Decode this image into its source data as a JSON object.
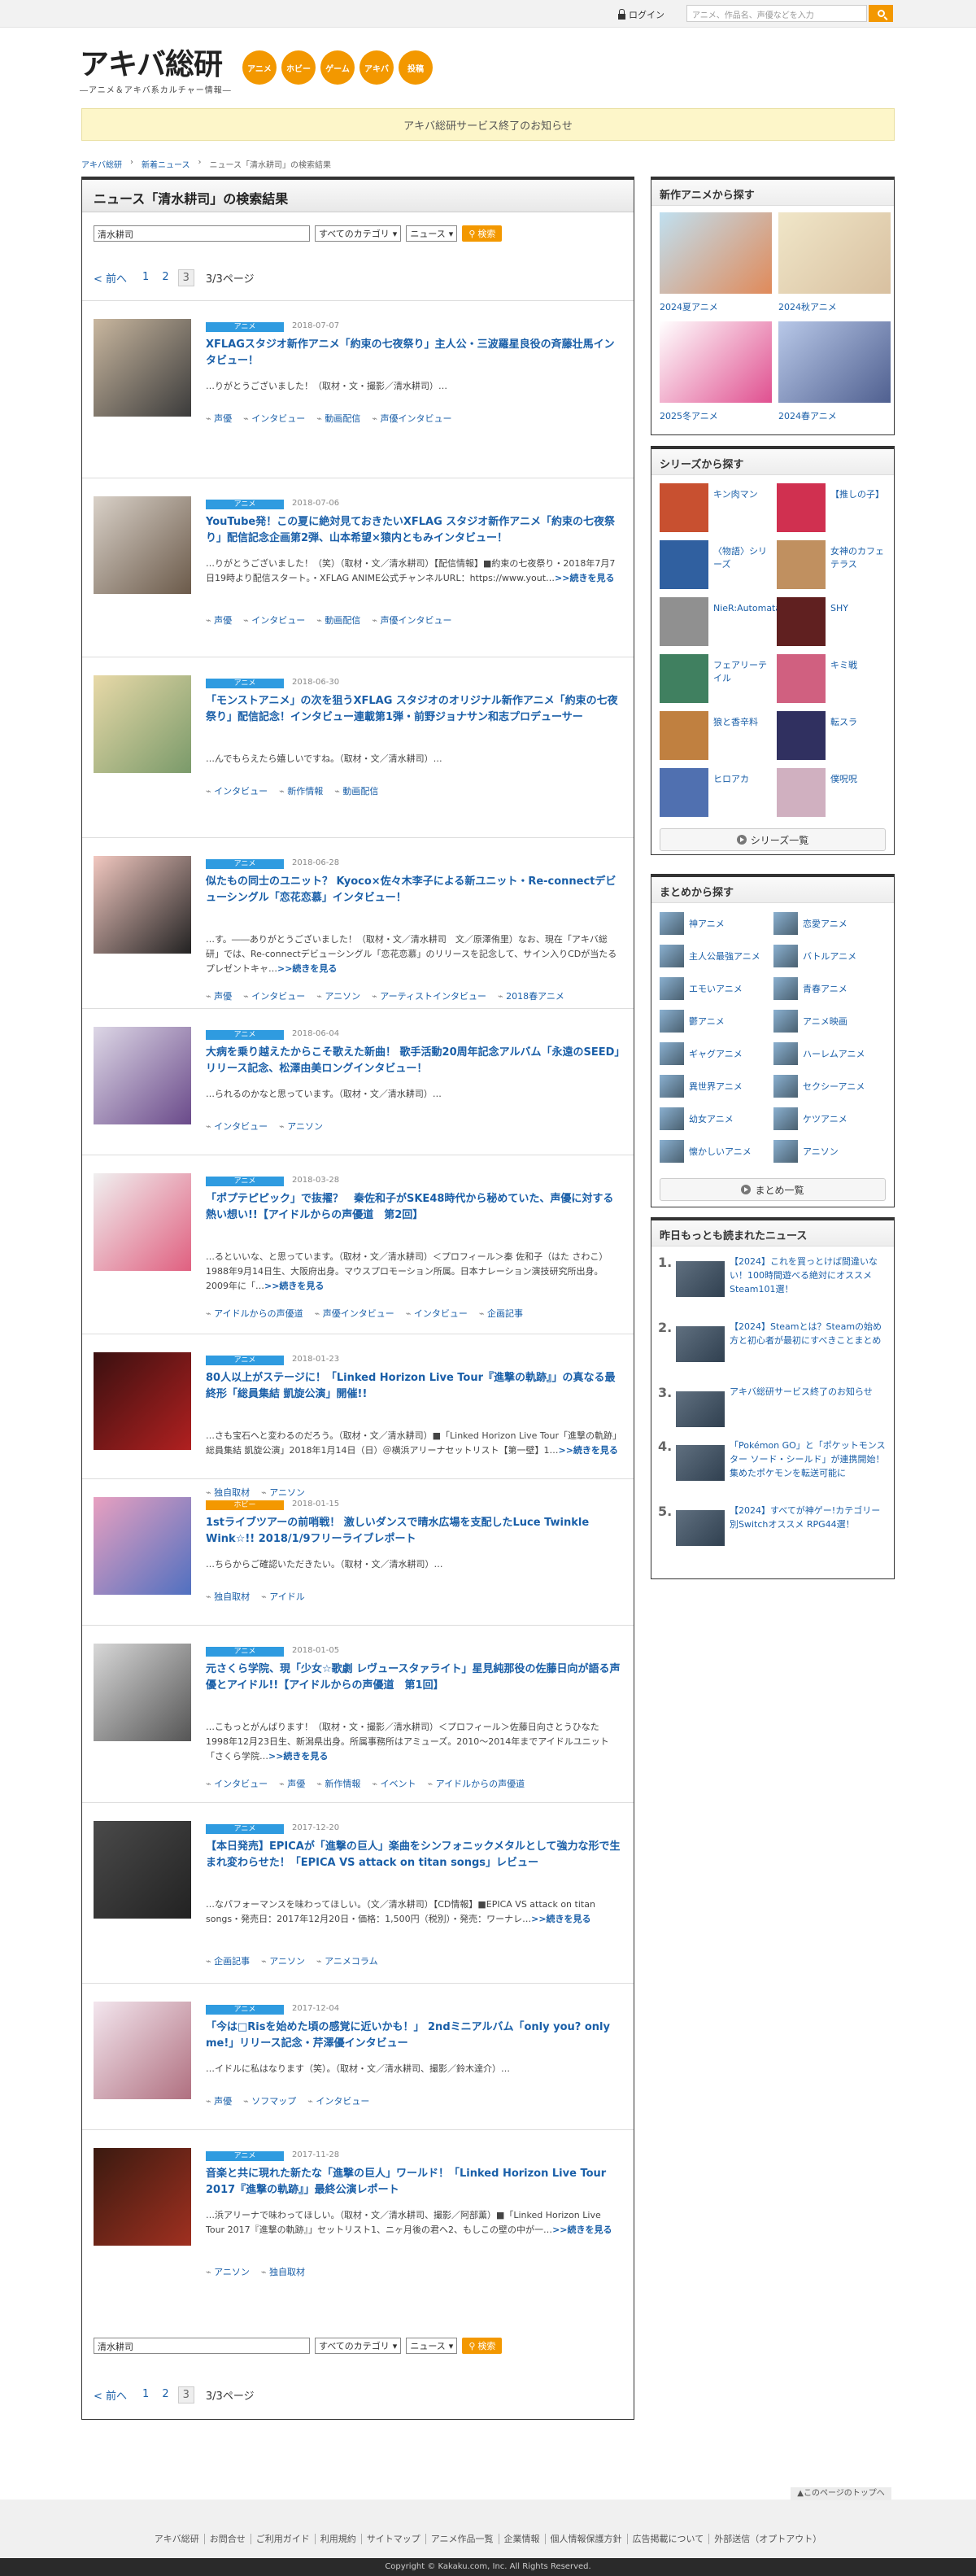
{
  "header": {
    "login": "ログイン",
    "search_placeholder": "アニメ、作品名、声優などを入力",
    "logo": "アキバ総研",
    "logo_sub": "―アニメ＆アキバ系カルチャー情報―",
    "categories": [
      "アニメ",
      "ホビー",
      "ゲーム",
      "アキバ",
      "投稿"
    ]
  },
  "notice": "アキバ総研サービス終了のお知らせ",
  "breadcrumb": [
    "アキバ総研",
    "新着ニュース",
    "ニュース「清水耕司」の検索結果"
  ],
  "main": {
    "title": "ニュース「清水耕司」の検索結果",
    "search_value": "清水耕司",
    "category_select": "すべてのカテゴリ",
    "type_select": "ニュース",
    "search_btn": "検索",
    "pager": {
      "prev": "前へ",
      "pages": [
        "1",
        "2",
        "3"
      ],
      "current": "3",
      "summary": "3/3ページ"
    }
  },
  "articles": [
    {
      "cat": "アニメ",
      "date": "2018-07-07",
      "title": "XFLAGスタジオ新作アニメ「約束の七夜祭り」主人公・三波羅星良役の斉藤壮馬インタビュー！",
      "summary": "…りがとうございました！（取材・文・撮影／清水耕司）…",
      "more": "",
      "tags": [
        "声優",
        "インタビュー",
        "動画配信",
        "声優インタビュー"
      ]
    },
    {
      "cat": "アニメ",
      "date": "2018-07-06",
      "title": "YouTube発！この夏に絶対見ておきたいXFLAG スタジオ新作アニメ「約束の七夜祭り」配信記念企画第2弾、山本希望×猿内ともみインタビュー！",
      "summary": "…りがとうございました！（笑）（取材・文／清水耕司）【配信情報】■約束の七夜祭り・2018年7月7日19時より配信スタート。・XFLAG ANIME公式チャンネルURL：https://www.yout…",
      "more": ">>続きを見る",
      "tags": [
        "声優",
        "インタビュー",
        "動画配信",
        "声優インタビュー"
      ]
    },
    {
      "cat": "アニメ",
      "date": "2018-06-30",
      "title": "「モンストアニメ」の次を狙うXFLAG スタジオのオリジナル新作アニメ「約束の七夜祭り」配信記念！インタビュー連載第1弾・前野ジョナサン和志プロデューサー",
      "summary": "…んでもらえたら嬉しいですね。（取材・文／清水耕司）…",
      "more": "",
      "tags": [
        "インタビュー",
        "新作情報",
        "動画配信"
      ]
    },
    {
      "cat": "アニメ",
      "date": "2018-06-28",
      "title": "似たもの同士のユニット？ Kyoco×佐々木李子による新ユニット・Re-connectデビューシングル「恋花恋慕」インタビュー！",
      "summary": "…す。――ありがとうございました！（取材・文／清水耕司　文／原澤侑里）なお、現在「アキバ総研」では、Re-connectデビューシングル「恋花恋慕」のリリースを記念して、サイン入りCDが当たるプレゼントキャ…",
      "more": ">>続きを見る",
      "tags": [
        "声優",
        "インタビュー",
        "アニソン",
        "アーティストインタビュー",
        "2018春アニメ"
      ]
    },
    {
      "cat": "アニメ",
      "date": "2018-06-04",
      "title": "大病を乗り越えたからこそ歌えた新曲！ 歌手活動20周年記念アルバム「永遠のSEED」リリース記念、松澤由美ロングインタビュー！",
      "summary": "…られるのかなと思っています。（取材・文／清水耕司）…",
      "more": "",
      "tags": [
        "インタビュー",
        "アニソン"
      ]
    },
    {
      "cat": "アニメ",
      "date": "2018-03-28",
      "title": "「ポプテピピック」で抜擢？　秦佐和子がSKE48時代から秘めていた、声優に対する熱い想い!!【アイドルからの声優道　第2回】",
      "summary": "…るといいな、と思っています。（取材・文／清水耕司）＜プロフィール＞秦 佐和子（はた さわこ）1988年9月14日生、大阪府出身。マウスプロモーション所属。日本ナレーション演技研究所出身。2009年に「…",
      "more": ">>続きを見る",
      "tags": [
        "アイドルからの声優道",
        "声優インタビュー",
        "インタビュー",
        "企画記事"
      ]
    },
    {
      "cat": "アニメ",
      "date": "2018-01-23",
      "title": "80人以上がステージに！「Linked Horizon Live Tour『進撃の軌跡』」の真なる最終形「総員集結 凱旋公演」開催!!",
      "summary": "…さも宝石へと変わるのだろう。（取材・文／清水耕司）■「Linked Horizon Live Tour「進撃の軌跡」総員集結 凱旋公演」2018年1月14日（日）＠横浜アリーナセットリスト【第一壁】1…",
      "more": ">>続きを見る",
      "tags": [
        "独自取材",
        "アニソン"
      ]
    },
    {
      "cat": "ホビー",
      "date": "2018-01-15",
      "title": "1stライブツアーの前哨戦！ 激しいダンスで晴水広場を支配したLuce Twinkle Wink☆!! 2018/1/9フリーライブレポート",
      "summary": "…ちらからご確認いただきたい。（取材・文／清水耕司）…",
      "more": "",
      "tags": [
        "独自取材",
        "アイドル"
      ]
    },
    {
      "cat": "アニメ",
      "date": "2018-01-05",
      "title": "元さくら学院、現「少女☆歌劇 レヴュースタァライト」星見純那役の佐藤日向が語る声優とアイドル!!【アイドルからの声優道　第1回】",
      "summary": "…こもっとがんばります！（取材・文・撮影／清水耕司）＜プロフィール＞佐藤日向さとうひなた1998年12月23日生、新潟県出身。所属事務所はアミューズ。2010～2014年までアイドルユニット「さくら学院…",
      "more": ">>続きを見る",
      "tags": [
        "インタビュー",
        "声優",
        "新作情報",
        "イベント",
        "アイドルからの声優道"
      ]
    },
    {
      "cat": "アニメ",
      "date": "2017-12-20",
      "title": "【本日発売】EPICAが「進撃の巨人」楽曲をシンフォニックメタルとして強力な形で生まれ変わらせた！「EPICA VS attack on titan songs」レビュー",
      "summary": "…なパフォーマンスを味わってほしい。（文／清水耕司）【CD情報】■EPICA VS attack on titan songs・発売日：2017年12月20日・価格：1,500円（税別）・発売：ワーナレ…",
      "more": ">>続きを見る",
      "tags": [
        "企画記事",
        "アニソン",
        "アニメコラム"
      ]
    },
    {
      "cat": "アニメ",
      "date": "2017-12-04",
      "title": "「今は□Risを始めた頃の感覚に近いかも！」 2ndミニアルバム「only you? only me!」リリース記念・芹澤優インタビュー",
      "summary": "…イドルに私はなります（笑）。（取材・文／清水耕司、撮影／鈴木達介）…",
      "more": "",
      "tags": [
        "声優",
        "ソフマップ",
        "インタビュー"
      ]
    },
    {
      "cat": "アニメ",
      "date": "2017-11-28",
      "title": "音楽と共に現れた新たな「進撃の巨人」ワールド！「Linked Horizon Live Tour 2017『進撃の軌跡』」最終公演レポート",
      "summary": "…浜アリーナで味わってほしい。（取材・文／清水耕司、撮影／阿部薫）■「Linked Horizon Live Tour 2017『進撃の軌跡』」セットリスト1、ニヶ月後の君へ2、もしこの壁の中が一…",
      "more": ">>続きを見る",
      "tags": [
        "アニソン",
        "独自取材"
      ]
    }
  ],
  "sidebar": {
    "new_anime": {
      "title": "新作アニメから探す",
      "items": [
        "2024夏アニメ",
        "2024秋アニメ",
        "2025冬アニメ",
        "2024春アニメ"
      ]
    },
    "series": {
      "title": "シリーズから探す",
      "items": [
        "キン肉マン",
        "【推しの子】",
        "〈物語〉シリーズ",
        "女神のカフェテラス",
        "NieR:Automata",
        "SHY",
        "フェアリーテイル",
        "キミ戦",
        "狼と香辛料",
        "転スラ",
        "ヒロアカ",
        "僕呪呪"
      ],
      "more": "シリーズ一覧"
    },
    "matome": {
      "title": "まとめから探す",
      "items": [
        "神アニメ",
        "恋愛アニメ",
        "主人公最強アニメ",
        "バトルアニメ",
        "エモいアニメ",
        "青春アニメ",
        "鬱アニメ",
        "アニメ映画",
        "ギャグアニメ",
        "ハーレムアニメ",
        "異世界アニメ",
        "セクシーアニメ",
        "幼女アニメ",
        "ケツアニメ",
        "懐かしいアニメ",
        "アニソン"
      ],
      "more": "まとめ一覧"
    },
    "ranking": {
      "title": "昨日もっとも読まれたニュース",
      "items": [
        {
          "rank": "1.",
          "text": "【2024】これを買っとけば間違いない！100時間遊べる絶対にオススメSteam101選！"
        },
        {
          "rank": "2.",
          "text": "【2024】Steamとは？Steamの始め方と初心者が最初にすべきことまとめ"
        },
        {
          "rank": "3.",
          "text": "アキバ総研サービス終了のお知らせ"
        },
        {
          "rank": "4.",
          "text": "「Pokémon GO」と「ポケットモンスター ソード・シールド」が連携開始！ 集めたポケモンを転送可能に"
        },
        {
          "rank": "5.",
          "text": "【2024】すべてが神ゲー!カテゴリー別Switchオススメ RPG44選！"
        }
      ]
    }
  },
  "footer": {
    "pagetop": "▲このページのトップへ",
    "links": [
      "アキバ総研",
      "お問合せ",
      "ご利用ガイド",
      "利用規約",
      "サイトマップ",
      "アニメ作品一覧",
      "企業情報",
      "個人情報保護方針",
      "広告掲載について",
      "外部送信（オプトアウト）"
    ],
    "copyright": "Copyright © Kakaku.com, Inc. All Rights Reserved."
  },
  "colors": {
    "accent": "#f39800",
    "link": "#1a5fa8",
    "tag": "#2f9be0"
  }
}
